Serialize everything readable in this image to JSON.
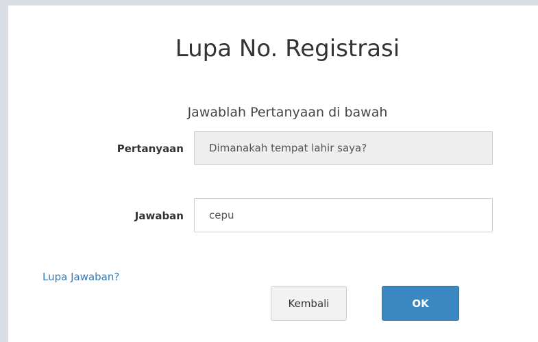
{
  "dialog": {
    "title": "Lupa No. Registrasi",
    "subtitle": "Jawablah Pertanyaan di bawah"
  },
  "form": {
    "question_label": "Pertanyaan",
    "question_value": "Dimanakah tempat lahir saya?",
    "answer_label": "Jawaban",
    "answer_value": "cepu"
  },
  "links": {
    "forgot_answer": "Lupa Jawaban?"
  },
  "buttons": {
    "back_label": "Kembali",
    "ok_label": "OK"
  },
  "colors": {
    "primary": "#3a87c2",
    "link": "#337ab7",
    "readonly_field_bg": "#eeeeee"
  }
}
